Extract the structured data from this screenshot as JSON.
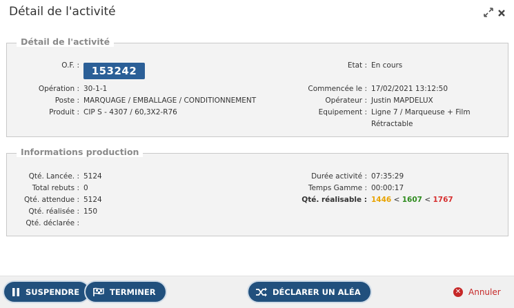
{
  "window": {
    "title": "Détail de l'activité",
    "expand_icon": "expand-arrows-icon",
    "close_icon": "close-icon"
  },
  "detail": {
    "legend": "Détail de l'activité",
    "of_label": "O.F. :",
    "of_value": "153242",
    "operation_label": "Opération :",
    "operation_value": "30-1-1",
    "poste_label": "Poste :",
    "poste_value": "MARQUAGE / EMBALLAGE / CONDITIONNEMENT",
    "produit_label": "Produit :",
    "produit_value": "CIP S - 4307 / 60,3X2-R76",
    "etat_label": "Etat :",
    "etat_value": "En cours",
    "commencee_label": "Commencée le :",
    "commencee_value": "17/02/2021 13:12:50",
    "operateur_label": "Opérateur :",
    "operateur_value": "Justin MAPDELUX",
    "equipement_label": "Equipement :",
    "equipement_value_line1": "Ligne 7 / Marqueuse + Film",
    "equipement_value_line2": "Rétractable"
  },
  "production": {
    "legend": "Informations production",
    "qte_lancee_label": "Qté. Lancée. :",
    "qte_lancee_value": "5124",
    "total_rebuts_label": "Total rebuts :",
    "total_rebuts_value": "0",
    "qte_attendue_label": "Qté. attendue :",
    "qte_attendue_value": "5124",
    "qte_realisee_label": "Qté. réalisée :",
    "qte_realisee_value": "150",
    "qte_declaree_label": "Qté. déclarée :",
    "duree_label": "Durée activité :",
    "duree_value": "07:35:29",
    "temps_gamme_label": "Temps Gamme :",
    "temps_gamme_value": "00:00:17",
    "qte_realisable_label": "Qté. réalisable :",
    "qte_realisable_min": "1446",
    "qte_realisable_mid": "1607",
    "qte_realisable_max": "1767",
    "lt_sign": "<",
    "colors": {
      "min": "#e8a300",
      "mid": "#2e8b1e",
      "max": "#d62f2f"
    }
  },
  "footer": {
    "suspend_label": "SUSPENDRE",
    "terminer_label": "TERMINER",
    "declarer_label": "DÉCLARER UN ALÉA",
    "annuler_label": "Annuler",
    "button_color": "#21507d"
  }
}
